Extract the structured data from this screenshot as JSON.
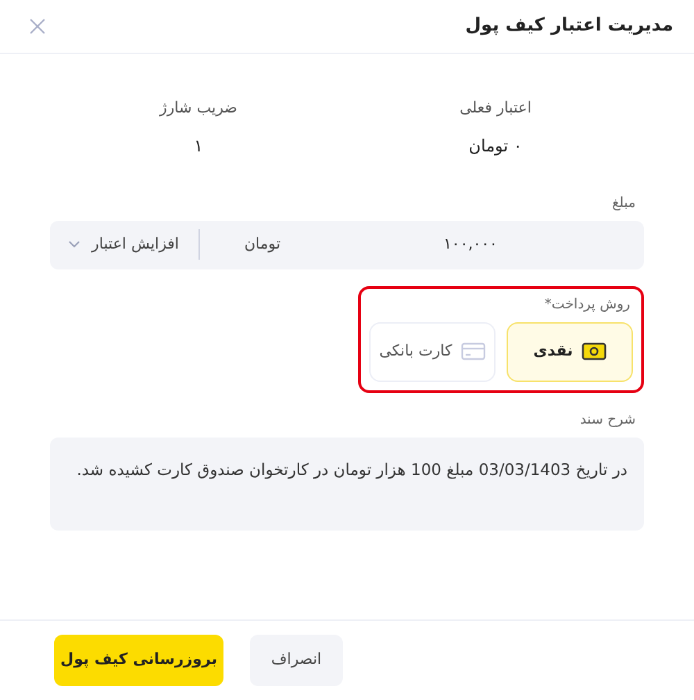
{
  "dialog": {
    "title": "مدیریت اعتبار کیف پول"
  },
  "info": [
    {
      "label": "اعتبار فعلی",
      "value": "۰ تومان"
    },
    {
      "label": "ضریب شارژ",
      "value": "۱"
    }
  ],
  "amount": {
    "label": "مبلغ",
    "value": "۱۰۰,۰۰۰",
    "unit": "تومان",
    "operation": "افزایش اعتبار"
  },
  "payment": {
    "label": "روش پرداخت*",
    "highlighted": true,
    "options": [
      {
        "kind": "cash",
        "label": "نقدی",
        "selected": true
      },
      {
        "kind": "card",
        "label": "کارت بانکی",
        "selected": false
      }
    ]
  },
  "description": {
    "label": "شرح سند",
    "value": "در تاریخ 03/03/1403 مبلغ 100 هزار تومان در کارتخوان صندوق کارت کشیده شد."
  },
  "buttons": [
    {
      "kind": "secondary",
      "label": "انصراف"
    },
    {
      "kind": "primary",
      "label": "بروزرسانی کیف پول"
    }
  ]
}
